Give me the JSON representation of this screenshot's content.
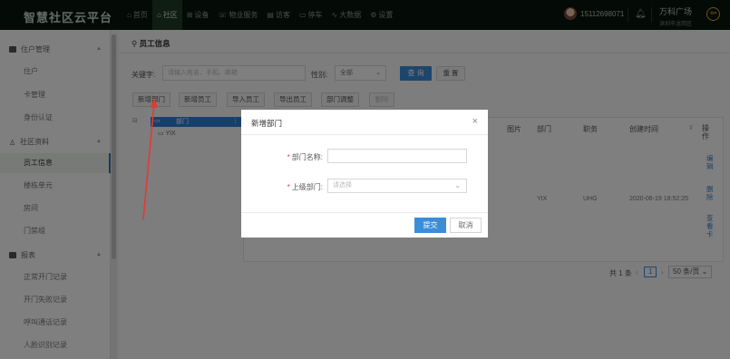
{
  "app": {
    "title": "智慧社区云平台"
  },
  "nav": [
    {
      "label": "首页",
      "icon": "home-icon"
    },
    {
      "label": "社区",
      "icon": "community-icon"
    },
    {
      "label": "设备",
      "icon": "device-icon"
    },
    {
      "label": "物业服务",
      "icon": "service-icon"
    },
    {
      "label": "访客",
      "icon": "visitor-icon"
    },
    {
      "label": "停车",
      "icon": "car-icon"
    },
    {
      "label": "大数据",
      "icon": "chart-icon"
    },
    {
      "label": "设置",
      "icon": "gear-icon"
    }
  ],
  "header": {
    "phone": "15112698071",
    "org_name": "万科广场",
    "org_sub": "深圳市龙岗区"
  },
  "sidebar": {
    "groups": [
      {
        "label": "住户管理",
        "items": [
          "住户",
          "卡管理",
          "身份认证"
        ]
      },
      {
        "label": "社区资料",
        "items": [
          "员工信息",
          "楼栋单元",
          "房间",
          "门禁组"
        ]
      },
      {
        "label": "报表",
        "items": [
          "正常开门记录",
          "开门失败记录",
          "呼叫通话记录",
          "人脸识别记录"
        ]
      }
    ]
  },
  "page": {
    "breadcrumb": "员工信息",
    "search": {
      "keyword_label": "关键字:",
      "keyword_placeholder": "请输入姓名、手机、邮箱",
      "gender_label": "性别:",
      "gender_value": "全部",
      "search_btn": "查 询",
      "reset_btn": "重 置"
    },
    "toolbar": [
      "新增部门",
      "新增员工",
      "导入员工",
      "导出员工",
      "部门调整",
      "删除"
    ],
    "tree": {
      "root": "部门",
      "child": "YIX"
    },
    "table": {
      "headers": [
        "图片",
        "部门",
        "职务",
        "创建时间",
        "操作"
      ],
      "row": {
        "dept": "YIX",
        "position": "UHG",
        "created": "2020-06-19 18:52:25",
        "ops": [
          "编辑",
          "删除",
          "查看卡"
        ]
      }
    },
    "pager": {
      "total": "共 1 条",
      "current": "1",
      "size": "50 条/页"
    }
  },
  "modal": {
    "title": "新增部门",
    "field_name_label": "部门名称:",
    "field_parent_label": "上级部门:",
    "parent_placeholder": "请选择",
    "submit": "提交",
    "cancel": "取消"
  },
  "colors": {
    "accent": "#3c8dd8",
    "topbar": "#08140c",
    "annotation": "#e53935"
  }
}
